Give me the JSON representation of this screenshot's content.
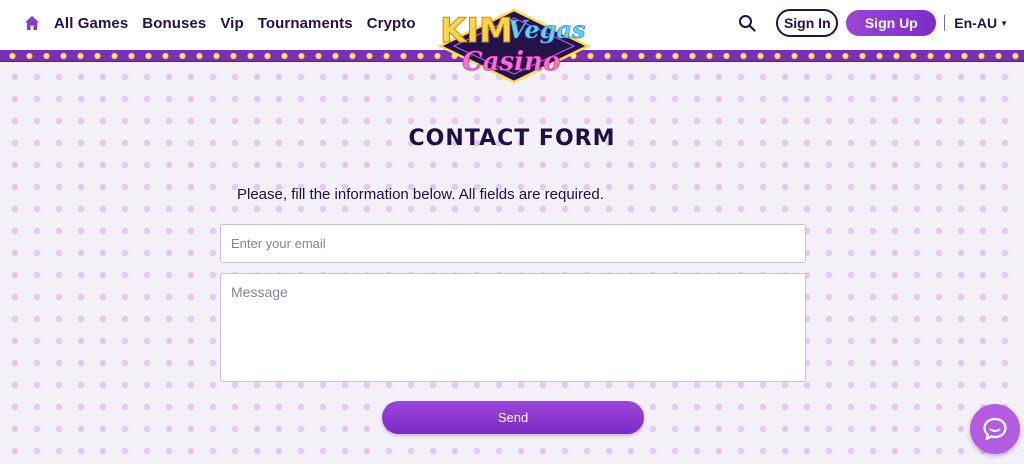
{
  "header": {
    "nav": [
      {
        "label": "All Games"
      },
      {
        "label": "Bonuses"
      },
      {
        "label": "Vip"
      },
      {
        "label": "Tournaments"
      },
      {
        "label": "Crypto"
      }
    ],
    "logo": {
      "line1": "KIM",
      "line2": "Vegas",
      "line3": "Casino"
    },
    "sign_in_label": "Sign In",
    "sign_up_label": "Sign Up",
    "language": "En-AU",
    "icons": {
      "home": "home-icon",
      "search": "search-icon",
      "language_caret": "caret-down-icon"
    }
  },
  "form": {
    "title": "CONTACT FORM",
    "subtitle": "Please, fill the information below. All fields are required.",
    "email_placeholder": "Enter your email",
    "email_value": "",
    "message_placeholder": "Message",
    "message_value": "",
    "send_label": "Send"
  },
  "chat": {
    "icon": "chat-bubble-icon"
  },
  "colors": {
    "accent": "#8a38cf",
    "text_dark": "#24134a",
    "page_background": "#f4f0f8",
    "dot_pattern": "#e6c6f2",
    "light_strip": "#7d2fb3",
    "chat_button": "#b35cdf"
  }
}
